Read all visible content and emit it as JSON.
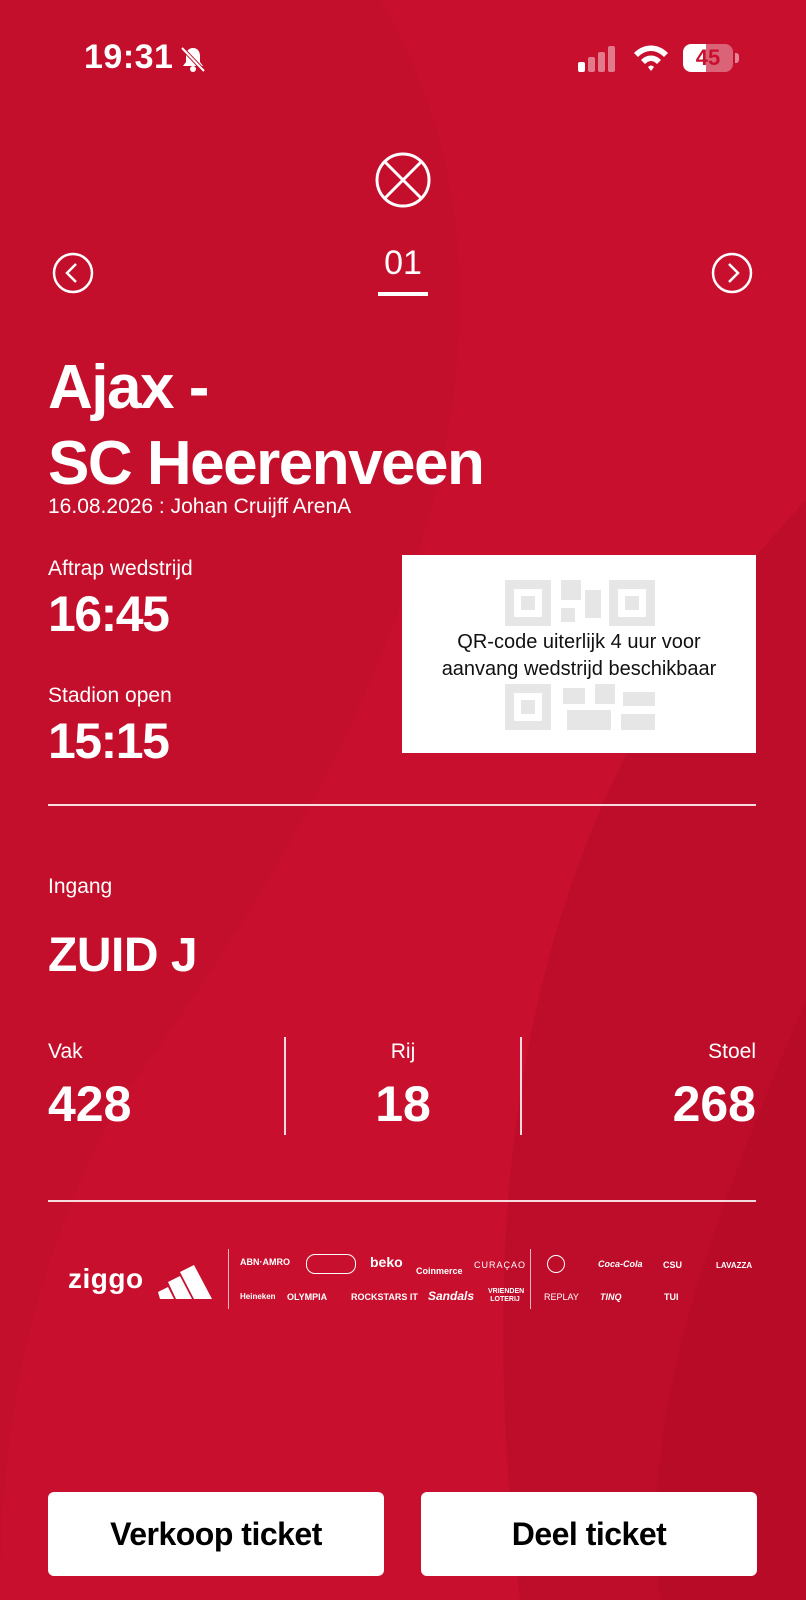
{
  "colors": {
    "background": "#c8102e",
    "foreground": "#ffffff",
    "button_text": "#000000"
  },
  "status_bar": {
    "time": "19:31",
    "battery": "45",
    "battery_level": 0.45
  },
  "icons": {
    "bell": "bell-slash-icon",
    "signal": "cellular-signal-icon",
    "wifi": "wifi-icon",
    "close": "close-circle-icon",
    "prev": "chevron-left-circle-icon",
    "next": "chevron-right-circle-icon"
  },
  "ticket": {
    "page": "01",
    "match_line1": "Ajax -",
    "match_line2": "SC Heerenveen",
    "date_venue": "16.08.2026 : Johan Cruijff ArenA",
    "kickoff_label": "Aftrap wedstrijd",
    "kickoff_time": "16:45",
    "stadium_open_label": "Stadion open",
    "stadium_open_time": "15:15",
    "qr_message_line1": "QR-code uiterlijk 4 uur voor",
    "qr_message_line2": "aanvang wedstrijd beschikbaar",
    "entrance_label": "Ingang",
    "entrance_value": "ZUID J",
    "section_label": "Vak",
    "section_value": "428",
    "row_label": "Rij",
    "row_value": "18",
    "seat_label": "Stoel",
    "seat_value": "268"
  },
  "sponsors": {
    "main": [
      "ziggo",
      "adidas"
    ],
    "row1": [
      "ABN·AMRO",
      "beko",
      "Coinmerce",
      "CURAÇAO",
      "Coca-Cola",
      "CSU",
      "LAVAZZA"
    ],
    "row2": [
      "Heineken",
      "OLYMPIA",
      "ROCKSTARS IT",
      "Sandals",
      "VRIENDEN LOTERIJ",
      "REPLAY",
      "TINQ",
      "TUI"
    ]
  },
  "buttons": {
    "sell": "Verkoop ticket",
    "share": "Deel ticket"
  }
}
